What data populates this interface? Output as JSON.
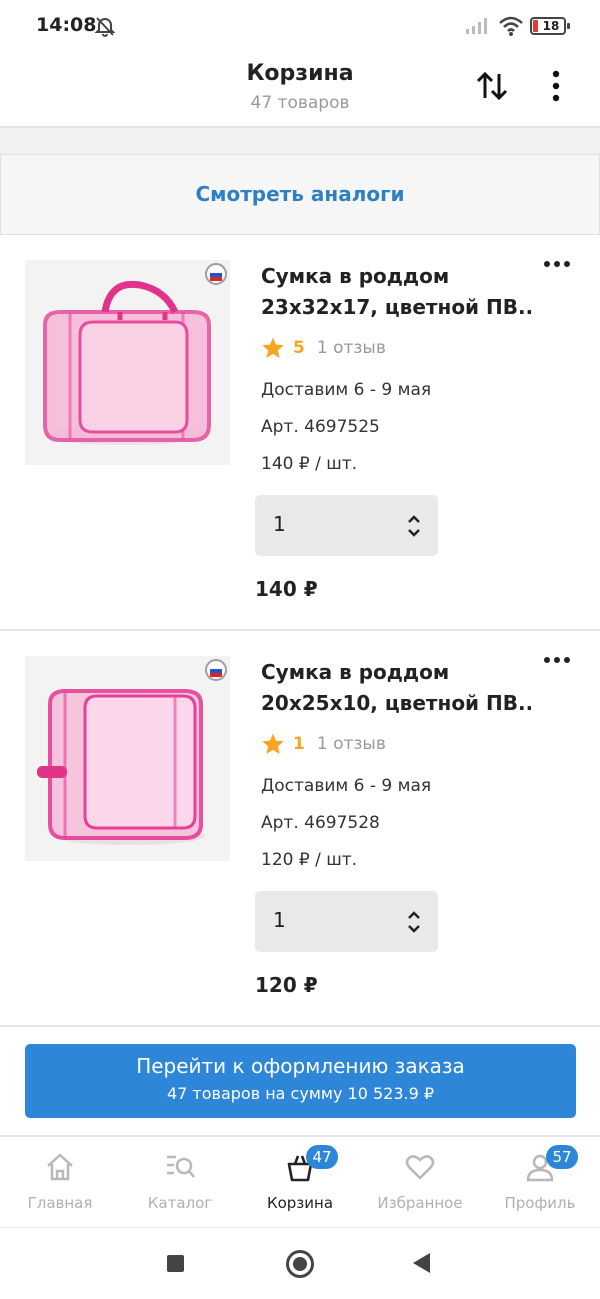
{
  "status_bar": {
    "time": "14:08",
    "battery_level": "18",
    "icons": [
      "bell-off-icon",
      "signal-icon",
      "wifi-icon",
      "battery-icon"
    ]
  },
  "header": {
    "title": "Корзина",
    "subtitle": "47 товаров",
    "sort_icon": "sort-arrows-icon",
    "more_icon": "more-vertical-icon"
  },
  "analogs_link": "Смотреть аналоги",
  "products": [
    {
      "title_line1": "Сумка в роддом",
      "title_line2": "23х32х17, цветной ПВ...",
      "rating": "5",
      "reviews": "1 отзыв",
      "delivery": "Доставим 6 - 9 мая",
      "article": "Арт. 4697525",
      "unit_price": "140 ₽ / шт.",
      "quantity": "1",
      "total": "140 ₽"
    },
    {
      "title_line1": "Сумка в роддом",
      "title_line2": "20х25х10, цветной ПВ...",
      "rating": "1",
      "reviews": "1 отзыв",
      "delivery": "Доставим 6 - 9 мая",
      "article": "Арт. 4697528",
      "unit_price": "120 ₽ / шт.",
      "quantity": "1",
      "total": "120 ₽"
    }
  ],
  "checkout": {
    "label": "Перейти к оформлению заказа",
    "summary": "47 товаров на сумму 10 523.9 ₽"
  },
  "bottom_nav": {
    "items": [
      {
        "label": "Главная",
        "icon": "home-icon"
      },
      {
        "label": "Каталог",
        "icon": "catalog-search-icon"
      },
      {
        "label": "Корзина",
        "icon": "cart-bag-icon",
        "badge": "47"
      },
      {
        "label": "Избранное",
        "icon": "heart-icon"
      },
      {
        "label": "Профиль",
        "icon": "profile-icon",
        "badge": "57"
      }
    ]
  },
  "colors": {
    "accent": "#2e86d9",
    "link": "#2e7fc4",
    "star": "#f5a623",
    "muted": "#999999"
  }
}
